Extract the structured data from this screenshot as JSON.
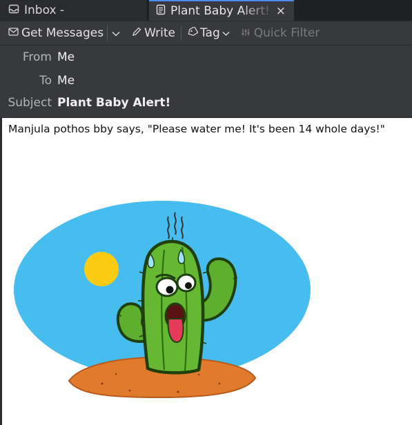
{
  "tabs": [
    {
      "label": "Inbox -",
      "icon": "inbox-icon"
    },
    {
      "label": "Plant Baby Alert!",
      "icon": "message-icon",
      "close": "×"
    }
  ],
  "toolbar": {
    "get_messages": "Get Messages",
    "write": "Write",
    "tag": "Tag",
    "quick_filter": "Quick Filter"
  },
  "header": {
    "from_label": "From",
    "from_value": "Me",
    "to_label": "To",
    "to_value": "Me",
    "subject_label": "Subject",
    "subject_value": "Plant Baby Alert!"
  },
  "message": {
    "body_text": "Manjula pothos bby says, \"Please water me! It's been 14 whole days!\""
  },
  "colors": {
    "accent": "#4a8df0",
    "header_bg": "#38393d",
    "tabbar_bg": "#1f2023"
  }
}
